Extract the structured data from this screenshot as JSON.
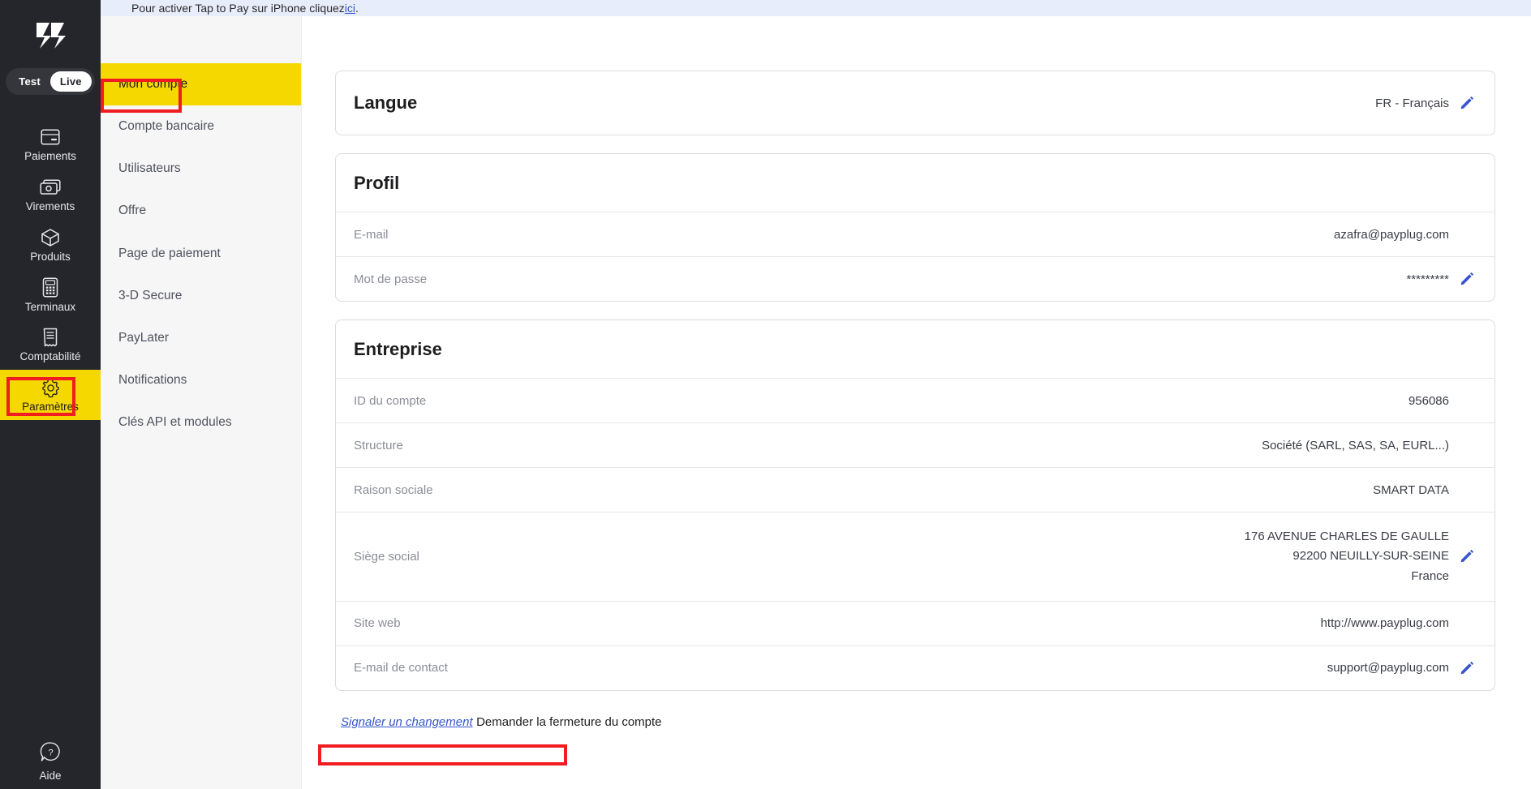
{
  "banner": {
    "text_before": "Pour activer Tap to Pay sur iPhone cliquez ",
    "link": "ici",
    "text_after": "."
  },
  "sidebar": {
    "logo": "payplug-logo",
    "env_toggle": {
      "test": "Test",
      "live": "Live",
      "active": "Live"
    },
    "items": [
      {
        "label": "Paiements",
        "icon": "card-icon"
      },
      {
        "label": "Virements",
        "icon": "transfer-icon"
      },
      {
        "label": "Produits",
        "icon": "box-icon"
      },
      {
        "label": "Terminaux",
        "icon": "terminal-icon"
      },
      {
        "label": "Comptabilité",
        "icon": "receipt-icon"
      },
      {
        "label": "Paramètres",
        "icon": "gear-icon"
      }
    ],
    "help": {
      "label": "Aide",
      "icon": "help-bubble-icon"
    }
  },
  "subnav": {
    "items": [
      {
        "label": "Mon compte"
      },
      {
        "label": "Compte bancaire"
      },
      {
        "label": "Utilisateurs"
      },
      {
        "label": "Offre"
      },
      {
        "label": "Page de paiement"
      },
      {
        "label": "3-D Secure"
      },
      {
        "label": "PayLater"
      },
      {
        "label": "Notifications"
      },
      {
        "label": "Clés API et modules"
      }
    ]
  },
  "langue": {
    "title": "Langue",
    "value": "FR - Français"
  },
  "profil": {
    "title": "Profil",
    "rows": [
      {
        "label": "E-mail",
        "value": "azafra@payplug.com",
        "editable": false
      },
      {
        "label": "Mot de passe",
        "value": "*********",
        "editable": true
      }
    ]
  },
  "entreprise": {
    "title": "Entreprise",
    "rows": [
      {
        "label": "ID du compte",
        "value": "956086"
      },
      {
        "label": "Structure",
        "value": "Société (SARL, SAS, SA, EURL...)"
      },
      {
        "label": "Raison sociale",
        "value": "SMART DATA"
      }
    ],
    "siege": {
      "label": "Siège social",
      "line1": "176 AVENUE CHARLES DE GAULLE",
      "line2": "92200  NEUILLY-SUR-SEINE",
      "line3": "France"
    },
    "site_web": {
      "label": "Site web",
      "value": "http://www.payplug.com"
    },
    "contact": {
      "label": "E-mail de contact",
      "value": "support@payplug.com"
    }
  },
  "footer": {
    "report_change": "Signaler un changement",
    "close_account": "Demander la fermeture du compte"
  },
  "colors": {
    "brand_yellow": "#f5d800",
    "sidebar_dark": "#25262b",
    "accent_blue": "#3355cc",
    "annotation_red": "#f01c21",
    "banner_blue": "#e8edfb"
  }
}
